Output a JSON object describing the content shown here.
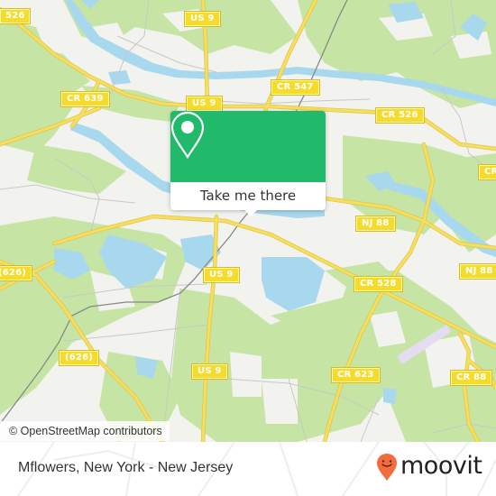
{
  "map": {
    "colors": {
      "land": "#f2f2ef",
      "forest": "#c6e5a5",
      "water": "#a7d8ed",
      "road": "#f6de5e",
      "road_edge": "#e2c547",
      "minor_road": "#c8c8c8",
      "rail": "#888888",
      "airport": "#e6dcf2"
    },
    "road_labels": [
      {
        "id": "cr526-left",
        "text": "526"
      },
      {
        "id": "us9-top",
        "text": "US 9"
      },
      {
        "id": "cr639",
        "text": "CR 639"
      },
      {
        "id": "us9-mid",
        "text": "US 9"
      },
      {
        "id": "cr547",
        "text": "CR 547"
      },
      {
        "id": "cr526-right",
        "text": "CR 526"
      },
      {
        "id": "cr-right-edge",
        "text": "CR"
      },
      {
        "id": "nj88-a",
        "text": "NJ 88"
      },
      {
        "id": "nj88-b",
        "text": "NJ 88"
      },
      {
        "id": "626-left",
        "text": "(626)"
      },
      {
        "id": "626-lower",
        "text": "(626)"
      },
      {
        "id": "us9-center",
        "text": "US 9"
      },
      {
        "id": "cr528",
        "text": "CR 528"
      },
      {
        "id": "us9-lower",
        "text": "US 9"
      },
      {
        "id": "cr623",
        "text": "CR 623"
      },
      {
        "id": "cr88",
        "text": "CR 88"
      }
    ],
    "attribution": "© OpenStreetMap contributors"
  },
  "popup": {
    "icon": "map-pin-icon",
    "button_label": "Take me there",
    "color": "#20ba6a"
  },
  "footer": {
    "title": "Mflowers, New York - New Jersey",
    "brand": "moovit",
    "brand_icon": "moovit-pin-smile-icon",
    "brand_color": "#f26c3d"
  }
}
